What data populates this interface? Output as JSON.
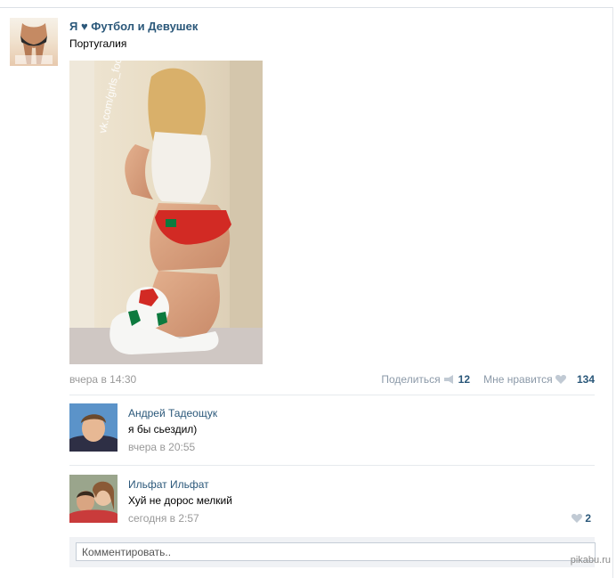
{
  "post": {
    "author": "Я ♥ Футбол и Девушек",
    "text": "Португалия",
    "photo_watermark": "vk.com/girls_football",
    "avatar_caption": "Я ♥ Футбол и Девушек vk.com/girls_football",
    "date": "вчера в 14:30",
    "share_label": "Поделиться",
    "share_count": "12",
    "like_label": "Мне нравится",
    "like_count": "134"
  },
  "comments": [
    {
      "author": "Андрей Тадеощук",
      "text": "я бы сьездил)",
      "date": "вчера в 20:55",
      "likes": ""
    },
    {
      "author": "Ильфат Ильфат",
      "text": "Хуй не дорос мелкий",
      "date": "сегодня в 2:57",
      "likes": "2"
    }
  ],
  "comment_input": {
    "placeholder": "Комментировать.."
  },
  "site_mark": "pikabu.ru",
  "colors": {
    "link": "#2b587a",
    "meta": "#999999",
    "action": "#8b99a8",
    "accent_red": "#d22a24",
    "accent_green": "#0c7a3e"
  },
  "icons": [
    "megaphone-icon",
    "heart-icon"
  ]
}
